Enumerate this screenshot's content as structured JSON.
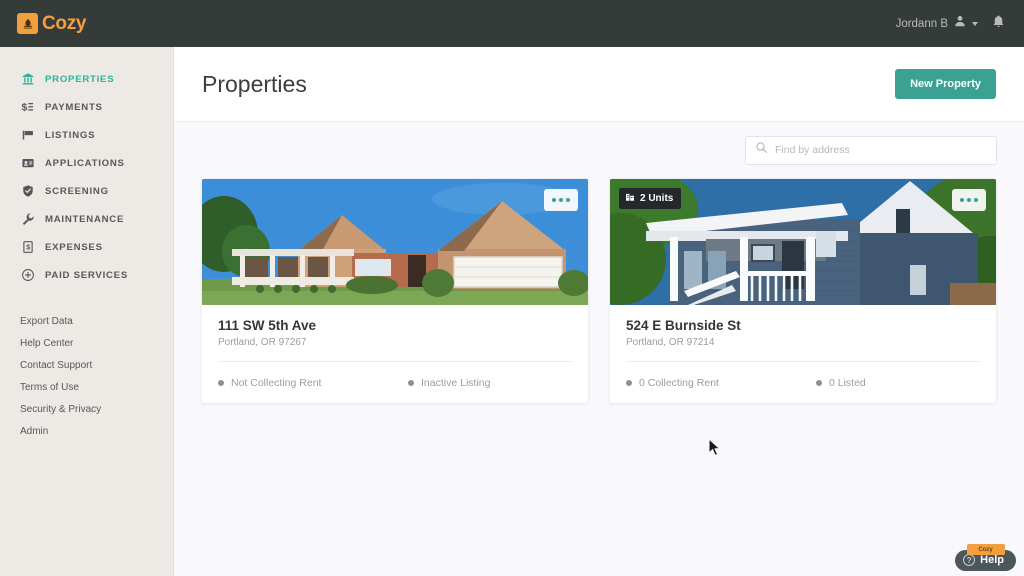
{
  "topbar": {
    "logo_text": "Cozy",
    "logo_icon": "campfire-icon",
    "user_name": "Jordann B",
    "user_icon": "user-avatar-icon",
    "notifications_icon": "bell-icon",
    "background_color": "#353B38",
    "accent_color": "#F2A03D"
  },
  "sidebar": {
    "background_color": "#EDEAE5",
    "active_color": "#2FB39A",
    "items": [
      {
        "label": "PROPERTIES",
        "icon": "bank-building-icon",
        "active": true
      },
      {
        "label": "PAYMENTS",
        "icon": "dollar-list-icon",
        "active": false
      },
      {
        "label": "LISTINGS",
        "icon": "flag-icon",
        "active": false
      },
      {
        "label": "APPLICATIONS",
        "icon": "id-card-icon",
        "active": false
      },
      {
        "label": "SCREENING",
        "icon": "shield-check-icon",
        "active": false
      },
      {
        "label": "MAINTENANCE",
        "icon": "wrench-icon",
        "active": false
      },
      {
        "label": "EXPENSES",
        "icon": "receipt-icon",
        "active": false
      },
      {
        "label": "PAID SERVICES",
        "icon": "plus-circle-icon",
        "active": false
      }
    ],
    "sublinks": [
      {
        "label": "Export Data"
      },
      {
        "label": "Help Center"
      },
      {
        "label": "Contact Support"
      },
      {
        "label": "Terms of Use"
      },
      {
        "label": "Security & Privacy"
      },
      {
        "label": "Admin"
      }
    ]
  },
  "header": {
    "title": "Properties",
    "new_property_label": "New Property",
    "button_color": "#3BA192"
  },
  "search": {
    "placeholder": "Find by address",
    "value": "",
    "icon": "search-icon"
  },
  "properties": [
    {
      "title": "111 SW 5th Ave",
      "subtitle": "Portland, OR 97267",
      "photo_alt": "single-story-tan-ranch-house",
      "units_badge": null,
      "menu_icon": "ellipsis-icon",
      "stats": [
        {
          "label": "Not Collecting Rent",
          "dot_color": "#8E9095"
        },
        {
          "label": "Inactive Listing",
          "dot_color": "#8E9095"
        }
      ]
    },
    {
      "title": "524 E Burnside St",
      "subtitle": "Portland, OR 97214",
      "photo_alt": "blue-two-story-house-with-porch",
      "units_badge": {
        "label": "2 Units",
        "icon": "building-icon"
      },
      "menu_icon": "ellipsis-icon",
      "stats": [
        {
          "label": "0 Collecting Rent",
          "dot_color": "#8E9095"
        },
        {
          "label": "0 Listed",
          "dot_color": "#8E9095"
        }
      ]
    }
  ],
  "help_widget": {
    "label": "Help",
    "icon": "question-mark-icon",
    "badge_text": "Cozy"
  }
}
